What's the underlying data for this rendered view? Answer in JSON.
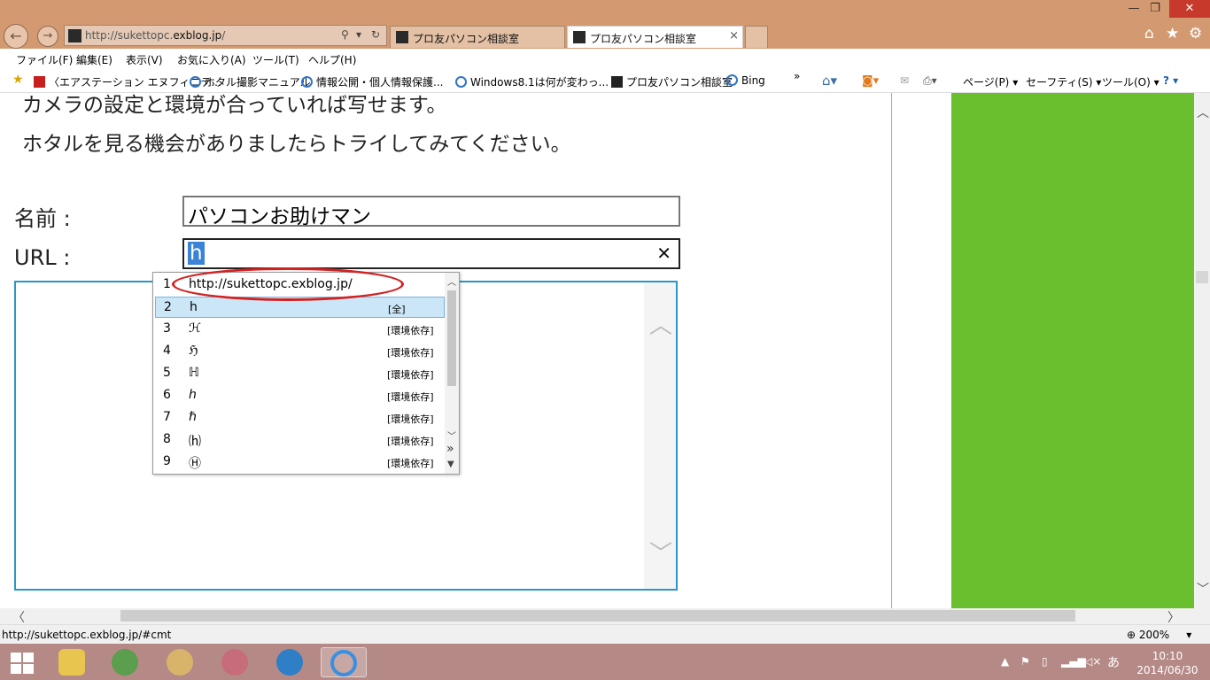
{
  "window": {
    "minimize": "—",
    "restore": "❐",
    "close": "✕"
  },
  "address_bar": {
    "url_prefix": "http://sukettopc.",
    "url_domain": "exblog.jp",
    "url_suffix": "/",
    "search_glyph": "⚲",
    "dropdown_glyph": "▾",
    "refresh_glyph": "↻"
  },
  "tabs": [
    {
      "title": "プロ友パソコン相談室"
    },
    {
      "title": "プロ友パソコン相談室",
      "close": "×"
    }
  ],
  "menu": [
    "ファイル(F)",
    "編集(E)",
    "表示(V)",
    "お気に入り(A)",
    "ツール(T)",
    "ヘルプ(H)"
  ],
  "favorites": [
    "〈エアステーション エヌフィニテ...",
    "ホタル撮影マニュアル",
    "情報公開・個人情報保護...",
    "Windows8.1は何が変わっ...",
    "プロ友パソコン相談室",
    "Bing"
  ],
  "command_bar": {
    "chevron": "»",
    "page": "ページ(P)",
    "safety": "セーフティ(S)",
    "tools": "ツール(O)",
    "help": "?"
  },
  "page": {
    "line1": "カメラの設定と環境が合っていれば写せます。",
    "line2": "ホタルを見る機会がありましたらトライしてみてください。",
    "name_label": "名前 :",
    "name_value": "パソコンお助けマン",
    "url_label": "URL :",
    "url_value": "h",
    "clear_glyph": "✕"
  },
  "ime_candidates": [
    {
      "n": "1",
      "word": "http://sukettopc.exblog.jp/",
      "tag": ""
    },
    {
      "n": "2",
      "word": "h",
      "tag": "[全]"
    },
    {
      "n": "3",
      "word": "ℋ",
      "tag": "[環境依存]"
    },
    {
      "n": "4",
      "word": "ℌ",
      "tag": "[環境依存]"
    },
    {
      "n": "5",
      "word": "ℍ",
      "tag": "[環境依存]"
    },
    {
      "n": "6",
      "word": "ℎ",
      "tag": "[環境依存]"
    },
    {
      "n": "7",
      "word": "ℏ",
      "tag": "[環境依存]"
    },
    {
      "n": "8",
      "word": "⒣",
      "tag": "[環境依存]"
    },
    {
      "n": "9",
      "word": "Ⓗ",
      "tag": "[環境依存]"
    }
  ],
  "ime_more": "»",
  "status": {
    "link": "http://sukettopc.exblog.jp/#cmt",
    "zoom": "200%",
    "zoom_glyph": "⊕",
    "zoom_dropdown": "▾"
  },
  "tray": {
    "ime": "あ",
    "time": "10:10",
    "date": "2014/06/30"
  }
}
